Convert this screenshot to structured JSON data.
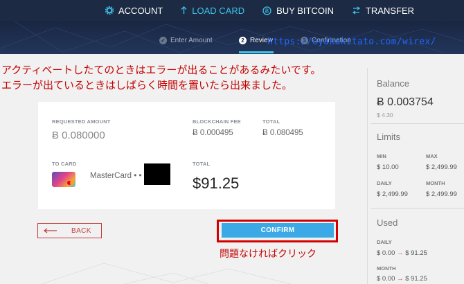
{
  "nav": {
    "items": [
      {
        "label": "ACCOUNT",
        "icon": "gear-icon",
        "active": false
      },
      {
        "label": "LOAD CARD",
        "icon": "arrow-up-icon",
        "active": true
      },
      {
        "label": "BUY BITCOIN",
        "icon": "bitcoin-icon",
        "active": false
      },
      {
        "label": "TRANSFER",
        "icon": "transfer-icon",
        "active": false
      }
    ]
  },
  "steps": [
    {
      "label": "Enter Amount",
      "marker": "✓"
    },
    {
      "label": "Review",
      "marker": "2"
    },
    {
      "label": "Confirmation",
      "marker": "3"
    }
  ],
  "overlay_url": "https://oyakokitato.com/wirex/",
  "annotation": {
    "line1": "アクティベートしたてのときはエラーが出ることがあるみたいです。",
    "line2": "エラーが出ているときはしばらく時間を置いたら出来ました。"
  },
  "summary": {
    "requested_amount_label": "REQUESTED AMOUNT",
    "requested_amount": "Ƀ 0.080000",
    "fee_label": "BLOCKCHAIN FEE",
    "fee": "Ƀ 0.000495",
    "total_btc_label": "TOTAL",
    "total_btc": "Ƀ 0.080495",
    "to_card_label": "TO CARD",
    "card_name": "MasterCard • •",
    "total_label": "TOTAL",
    "total": "$91.25"
  },
  "buttons": {
    "back": "BACK",
    "confirm": "CONFIRM"
  },
  "click_note": "問題なければクリック",
  "sidebar": {
    "balance_title": "Balance",
    "balance_btc": "Ƀ 0.003754",
    "balance_usd": "$ 4.30",
    "limits_title": "Limits",
    "limits": {
      "min_label": "MIN",
      "min": "$ 10.00",
      "max_label": "MAX",
      "max": "$ 2,499.99",
      "daily_label": "DAILY",
      "daily": "$ 2,499.99",
      "month_label": "MONTH",
      "month": "$ 2,499.99"
    },
    "used_title": "Used",
    "used": {
      "daily_label": "DAILY",
      "daily_from": "$ 0.00",
      "daily_arrow": "→",
      "daily_to": "$ 91.25",
      "month_label": "MONTH",
      "month_from": "$ 0.00",
      "month_arrow": "→",
      "month_to": "$ 91.25"
    }
  },
  "colors": {
    "nav_bg": "#1c2a44",
    "accent": "#3fc3e8",
    "confirm": "#3ba9e6",
    "annotation_red": "#c40000",
    "url_blue": "#1f66ff"
  }
}
